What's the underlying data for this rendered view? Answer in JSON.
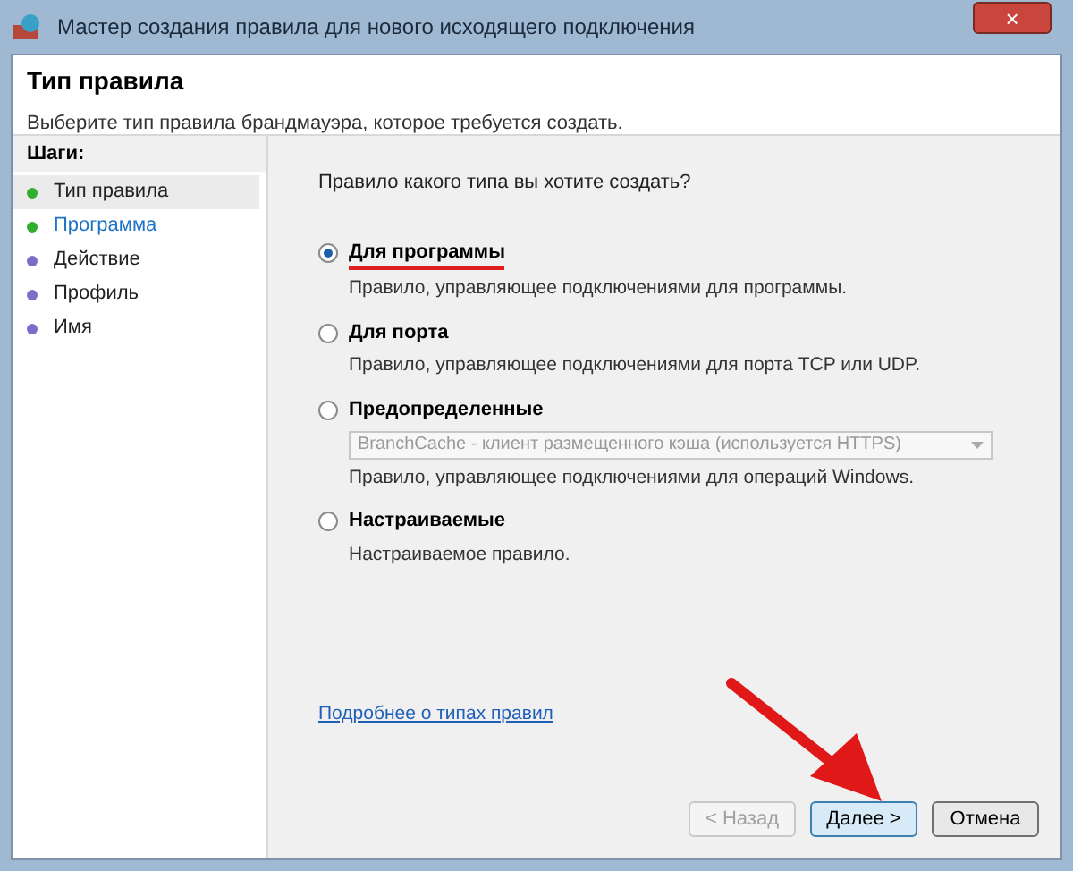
{
  "window": {
    "title": "Мастер создания правила для нового исходящего подключения",
    "close": "×"
  },
  "header": {
    "title": "Тип правила",
    "subtitle": "Выберите тип правила брандмауэра, которое требуется создать."
  },
  "steps_title": "Шаги:",
  "steps": [
    {
      "label": "Тип правила",
      "completed": true,
      "selected": true,
      "hovered": false
    },
    {
      "label": "Программа",
      "completed": true,
      "selected": false,
      "hovered": true
    },
    {
      "label": "Действие",
      "completed": false,
      "selected": false,
      "hovered": false
    },
    {
      "label": "Профиль",
      "completed": false,
      "selected": false,
      "hovered": false
    },
    {
      "label": "Имя",
      "completed": false,
      "selected": false,
      "hovered": false
    }
  ],
  "question": "Правило какого типа вы хотите создать?",
  "options": [
    {
      "label": "Для программы",
      "description": "Правило, управляющее подключениями для программы.",
      "selected": true,
      "underlined": true
    },
    {
      "label": "Для порта",
      "description": "Правило, управляющее подключениями для порта TCP или UDP.",
      "selected": false,
      "underlined": false
    },
    {
      "label": "Предопределенные",
      "dropdown": {
        "value": "BranchCache - клиент размещенного кэша (используется HTTPS)",
        "disabled": true
      },
      "description": "Правило, управляющее подключениями для операций Windows.",
      "selected": false,
      "underlined": false
    },
    {
      "label": "Настраиваемые",
      "description": "Настраиваемое правило.",
      "selected": false,
      "underlined": false
    }
  ],
  "link": "Подробнее о типах правил",
  "buttons": [
    {
      "label": "< Назад",
      "disabled": true,
      "default": false
    },
    {
      "label": "Далее >",
      "disabled": false,
      "default": true
    },
    {
      "label": "Отмена",
      "disabled": false,
      "default": false
    }
  ]
}
